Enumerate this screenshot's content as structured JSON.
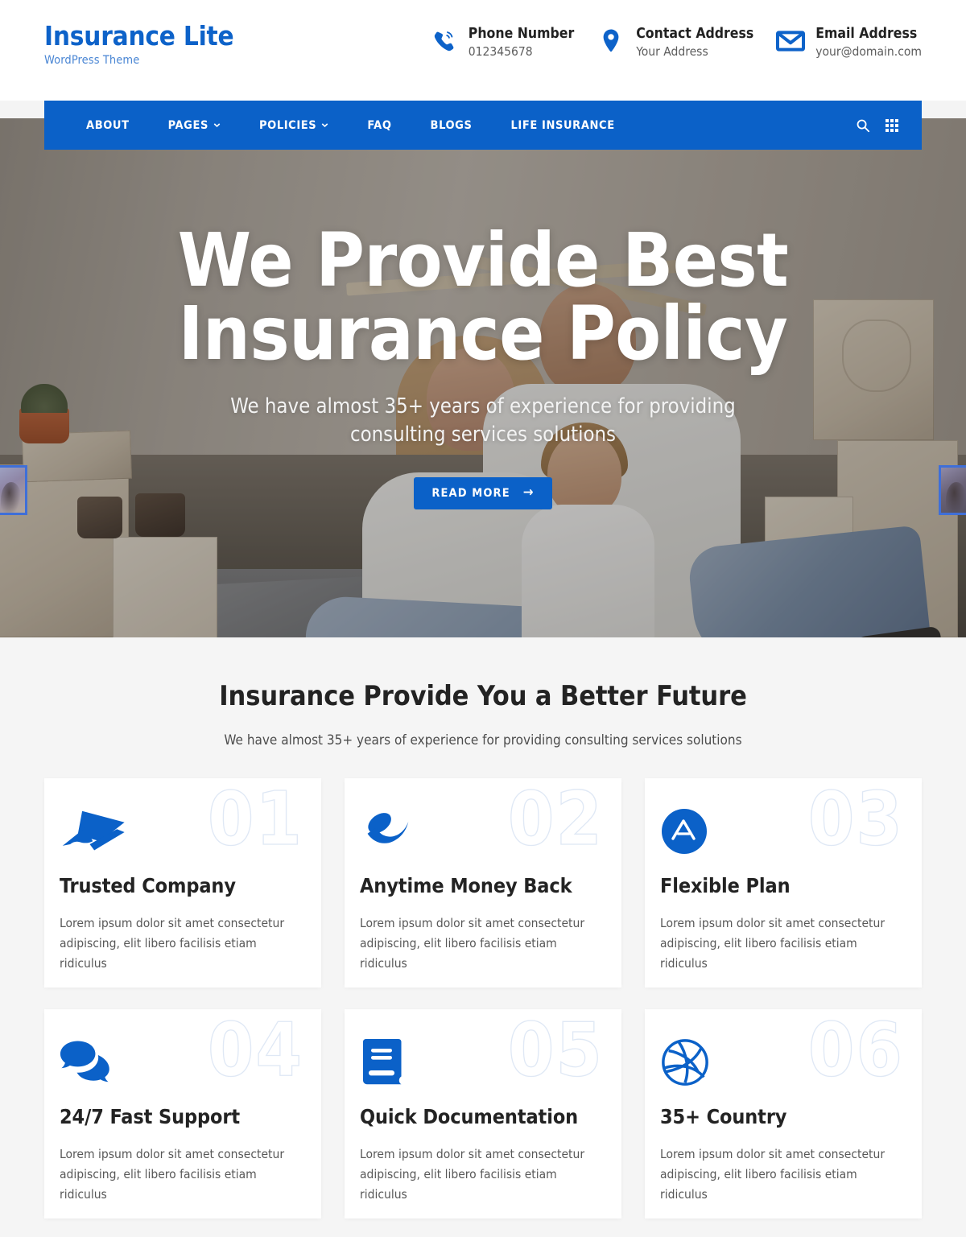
{
  "colors": {
    "brand_blue": "#0b61c8",
    "logo_blue": "#0d62c9",
    "logo_sub_blue": "#4a86d4",
    "section_bg": "#f5f5f5",
    "card_bg": "#ffffff",
    "heading_dark": "#232323",
    "number_outline": "#dfe8f5"
  },
  "header": {
    "brand_title": "Insurance Lite",
    "brand_subtitle": "WordPress Theme",
    "contacts": [
      {
        "icon": "phone-icon",
        "label": "Phone Number",
        "value": "012345678"
      },
      {
        "icon": "map-marker-icon",
        "label": "Contact Address",
        "value": "Your Address"
      },
      {
        "icon": "envelope-icon",
        "label": "Email Address",
        "value": "your@domain.com"
      }
    ]
  },
  "nav": {
    "items": [
      {
        "label": "ABOUT",
        "has_dropdown": false
      },
      {
        "label": "PAGES",
        "has_dropdown": true
      },
      {
        "label": "POLICIES",
        "has_dropdown": true
      },
      {
        "label": "FAQ",
        "has_dropdown": false
      },
      {
        "label": "BLOGS",
        "has_dropdown": false
      },
      {
        "label": "LIFE INSURANCE",
        "has_dropdown": false
      }
    ],
    "actions": [
      {
        "icon": "search-icon"
      },
      {
        "icon": "grid-menu-icon"
      }
    ]
  },
  "hero": {
    "title_line1": "We Provide Best",
    "title_line2": "Insurance Policy",
    "subtitle": "We have almost 35+ years of experience for providing consulting services solutions",
    "button_label": "READ MORE",
    "button_arrow": "→",
    "slider_thumb_left": "prev-slide-thumbnail",
    "slider_thumb_right": "next-slide-thumbnail"
  },
  "features": {
    "title": "Insurance Provide You a Better Future",
    "subtitle": "We have almost 35+ years of experience for providing consulting services solutions",
    "cards": [
      {
        "number": "01",
        "icon": "affiliate-theme-icon",
        "title": "Trusted Company",
        "text": "Lorem ipsum dolor sit amet consectetur adipiscing, elit libero facilisis etiam ridiculus"
      },
      {
        "number": "02",
        "icon": "aviato-icon",
        "title": "Anytime Money Back",
        "text": "Lorem ipsum dolor sit amet consectetur adipiscing, elit libero facilisis etiam ridiculus"
      },
      {
        "number": "03",
        "icon": "ansible-circle-icon",
        "title": "Flexible Plan",
        "text": "Lorem ipsum dolor sit amet consectetur adipiscing, elit libero facilisis etiam ridiculus"
      },
      {
        "number": "04",
        "icon": "comments-icon",
        "title": "24/7 Fast Support",
        "text": "Lorem ipsum dolor sit amet consectetur adipiscing, elit libero facilisis etiam ridiculus"
      },
      {
        "number": "05",
        "icon": "book-icon",
        "title": "Quick Documentation",
        "text": "Lorem ipsum dolor sit amet consectetur adipiscing, elit libero facilisis etiam ridiculus"
      },
      {
        "number": "06",
        "icon": "dribbble-icon",
        "title": "35+ Country",
        "text": "Lorem ipsum dolor sit amet consectetur adipiscing, elit libero facilisis etiam ridiculus"
      }
    ]
  }
}
